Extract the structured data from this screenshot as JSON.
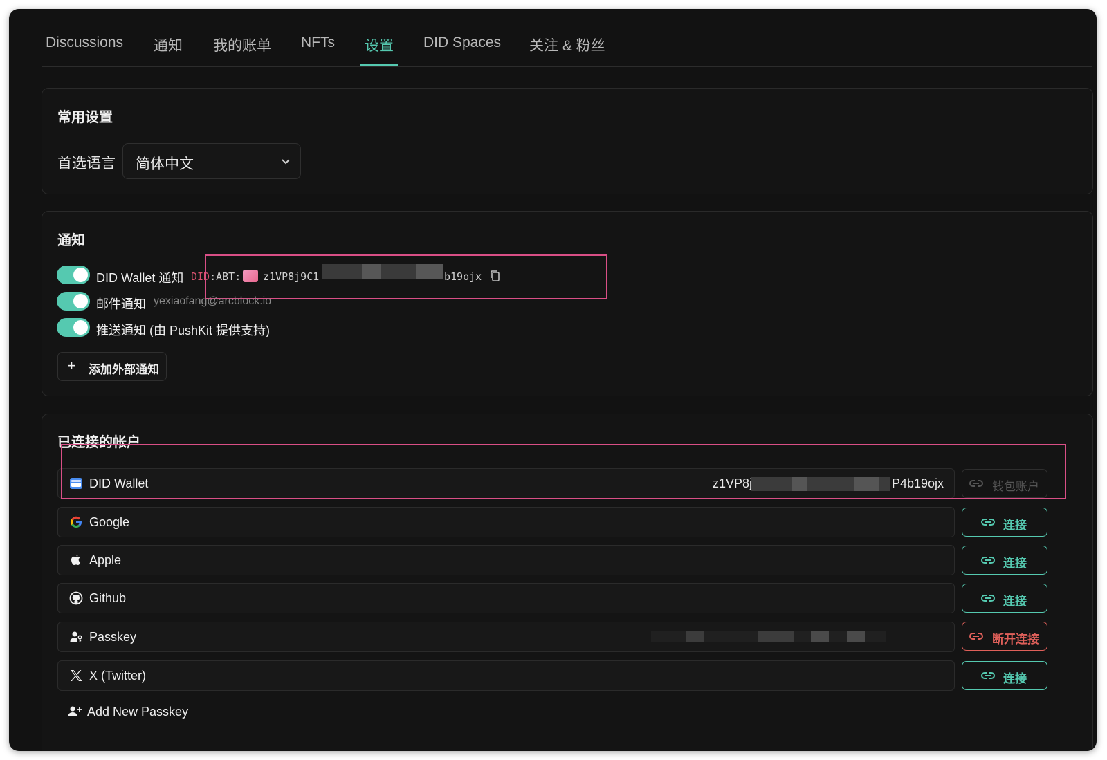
{
  "tabs": [
    "Discussions",
    "通知",
    "我的账单",
    "NFTs",
    "设置",
    "DID Spaces",
    "关注 & 粉丝"
  ],
  "active_tab": "设置",
  "accent_color": "#55c9b0",
  "danger_color": "#e0605a",
  "highlight_color": "#d94f86",
  "general": {
    "title": "常用设置",
    "language_label": "首选语言",
    "language_value": "简体中文"
  },
  "notifications": {
    "title": "通知",
    "items": [
      {
        "label": "DID Wallet 通知",
        "enabled": true,
        "did_prefix_red": "DID",
        "did_prefix": ":ABT:",
        "did_start": "z1VP8j9C1",
        "did_end": "b19ojx"
      },
      {
        "label": "邮件通知",
        "enabled": true,
        "detail": "yexiaofang@arcblock.io"
      },
      {
        "label": "推送通知 (由 PushKit 提供支持)",
        "enabled": true
      }
    ],
    "add_external": "添加外部通知"
  },
  "accounts": {
    "title": "已连接的帐户",
    "rows": [
      {
        "name": "DID Wallet",
        "icon": "wallet-icon",
        "id_start": "z1VP8j",
        "id_end": "P4b19ojx",
        "action": "钱包账户",
        "state": "disabled"
      },
      {
        "name": "Google",
        "icon": "google-icon",
        "action": "连接",
        "state": "connect"
      },
      {
        "name": "Apple",
        "icon": "apple-icon",
        "action": "连接",
        "state": "connect"
      },
      {
        "name": "Github",
        "icon": "github-icon",
        "action": "连接",
        "state": "connect"
      },
      {
        "name": "Passkey",
        "icon": "passkey-icon",
        "action": "断开连接",
        "state": "disconnect"
      },
      {
        "name": "X (Twitter)",
        "icon": "x-icon",
        "action": "连接",
        "state": "connect"
      }
    ],
    "add_passkey": "Add New Passkey"
  }
}
